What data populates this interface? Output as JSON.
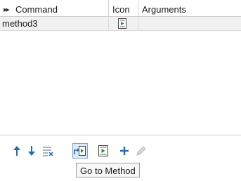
{
  "table": {
    "columns": {
      "command": "Command",
      "icon": "Icon",
      "arguments": "Arguments"
    },
    "rows": [
      {
        "command": "method3",
        "icon": "method-call-icon",
        "arguments": ""
      }
    ]
  },
  "toolbar": {
    "buttons": [
      {
        "name": "move-up",
        "icon": "arrow-up-icon"
      },
      {
        "name": "move-down",
        "icon": "arrow-down-icon"
      },
      {
        "name": "delete",
        "icon": "clear-list-icon"
      },
      {
        "name": "go-to-method",
        "icon": "go-to-method-icon",
        "active": true
      },
      {
        "name": "call-method",
        "icon": "call-method-icon"
      },
      {
        "name": "add",
        "icon": "plus-icon"
      },
      {
        "name": "edit",
        "icon": "pencil-icon",
        "disabled": true
      }
    ]
  },
  "tooltip": {
    "text": "Go to Method"
  },
  "colors": {
    "accent": "#1f6db5",
    "green": "#2e8b2e",
    "selection": "#dde9f6"
  }
}
